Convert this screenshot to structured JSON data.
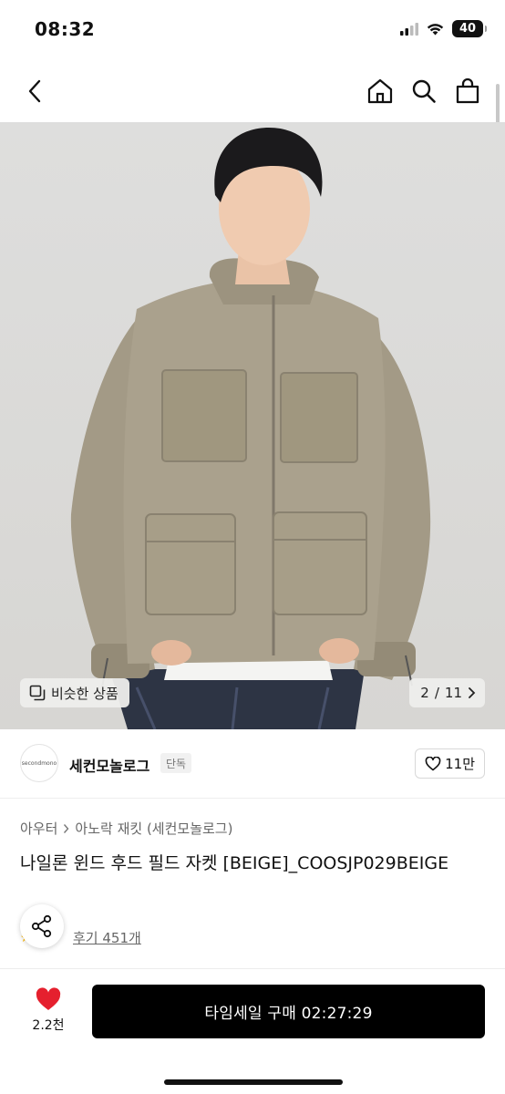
{
  "status_bar": {
    "time": "08:32",
    "battery": "40"
  },
  "nav": {
    "back_icon": "chevron-left-icon",
    "home_icon": "home-icon",
    "search_icon": "search-icon",
    "bag_icon": "shopping-bag-icon"
  },
  "gallery": {
    "similar_label": "비슷한 상품",
    "page_current": "2",
    "page_separator": "/",
    "page_total": "11"
  },
  "brand": {
    "logo_text": "secondmono",
    "name": "세컨모놀로그",
    "badge": "단독",
    "likes": "11만"
  },
  "breadcrumb": {
    "category": "아우터",
    "subcategory": "아노락 재킷 (세컨모놀로그)"
  },
  "product": {
    "title": "나일론 윈드 후드 필드 자켓 [BEIGE]_COOSJP029BEIGE"
  },
  "reviews": {
    "label": "후기 451개"
  },
  "bottom": {
    "heart_count": "2.2천",
    "buy_label": "타임세일 구매 02:27:29"
  },
  "colors": {
    "accent_heart": "#e5202e",
    "button_bg": "#000000",
    "jacket": "#a39a86"
  }
}
